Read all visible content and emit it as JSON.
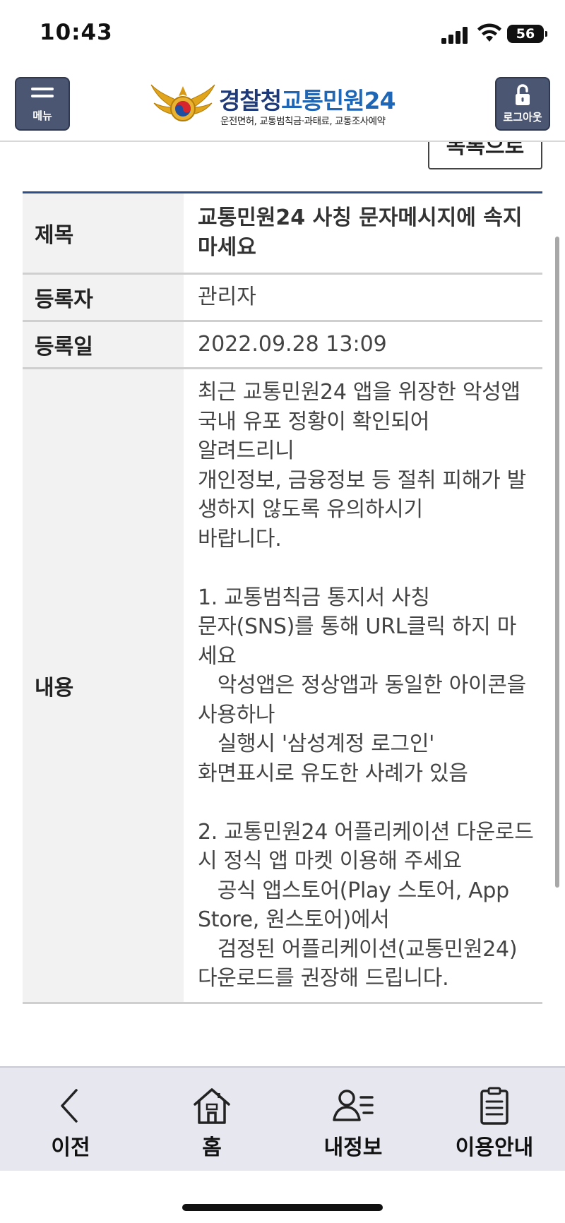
{
  "status_bar": {
    "time": "10:43",
    "battery": "56"
  },
  "header": {
    "menu_label": "메뉴",
    "logout_label": "로그아웃",
    "logo_title_part1": "경찰청",
    "logo_title_part2": "교통민원24",
    "logo_subtitle": "운전면허, 교통범칙금·과태료, 교통조사예약"
  },
  "list_button_label": "목록으로",
  "notice": {
    "title_label": "제목",
    "title_value": "교통민원24 사칭 문자메시지에 속지 마세요",
    "author_label": "등록자",
    "author_value": "관리자",
    "date_label": "등록일",
    "date_value": "2022.09.28 13:09",
    "content_label": "내용",
    "content_value": "최근 교통민원24 앱을 위장한 악성앱 국내 유포 정황이 확인되어\n알려드리니\n개인정보, 금융정보 등 절취 피해가 발생하지 않도록 유의하시기\n바랍니다.\n\n1. 교통범칙금 통지서 사칭\n문자(SNS)를 통해 URL클릭 하지 마세요\n   악성앱은 정상앱과 동일한 아이콘을 사용하나\n   실행시 '삼성계정 로그인'\n화면표시로 유도한 사례가 있음\n\n2. 교통민원24 어플리케이션 다운로드시 정식 앱 마켓 이용해 주세요\n   공식 앱스토어(Play 스토어, App Store, 원스토어)에서\n   검정된 어플리케이션(교통민원24)\n다운로드를 권장해 드립니다."
  },
  "bottom_nav": {
    "items": [
      {
        "label": "이전",
        "icon": "back-chevron-icon"
      },
      {
        "label": "홈",
        "icon": "home-icon"
      },
      {
        "label": "내정보",
        "icon": "user-info-icon"
      },
      {
        "label": "이용안내",
        "icon": "clipboard-icon"
      }
    ]
  }
}
